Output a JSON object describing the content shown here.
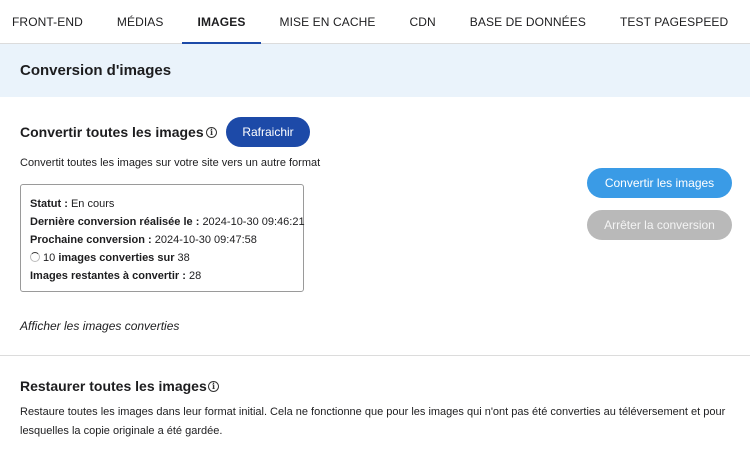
{
  "tabs": [
    {
      "label": "FRONT-END",
      "active": false
    },
    {
      "label": "MÉDIAS",
      "active": false
    },
    {
      "label": "IMAGES",
      "active": true
    },
    {
      "label": "MISE EN CACHE",
      "active": false
    },
    {
      "label": "CDN",
      "active": false
    },
    {
      "label": "BASE DE DONNÉES",
      "active": false
    },
    {
      "label": "TEST PAGESPEED",
      "active": false
    }
  ],
  "section": {
    "title": "Conversion d'images"
  },
  "convert": {
    "title": "Convertir toutes les images",
    "refresh_label": "Rafraichir",
    "description": "Convertit toutes les images sur votre site vers un autre format",
    "status": {
      "status_label": "Statut :",
      "status_value": "En cours",
      "last_label": "Dernière conversion réalisée le :",
      "last_value": "2024-10-30 09:46:21",
      "next_label": "Prochaine conversion :",
      "next_value": "2024-10-30 09:47:58",
      "converted_count": "10",
      "converted_label": "images converties sur",
      "converted_total": "38",
      "remaining_label": "Images restantes à convertir :",
      "remaining_value": "28"
    },
    "show_converted_label": "Afficher les images converties",
    "convert_button_label": "Convertir les images",
    "stop_button_label": "Arrêter la conversion"
  },
  "restore": {
    "title": "Restaurer toutes les images",
    "description": "Restaure toutes les images dans leur format initial. Cela ne fonctionne que pour les images qui n'ont pas été converties au téléversement et pour lesquelles la copie originale a été gardée."
  },
  "colors": {
    "accent_dark": "#1d4aa8",
    "accent_light": "#3a9be6",
    "disabled": "#b9b9b9",
    "header_bg": "#eaf3fb"
  }
}
